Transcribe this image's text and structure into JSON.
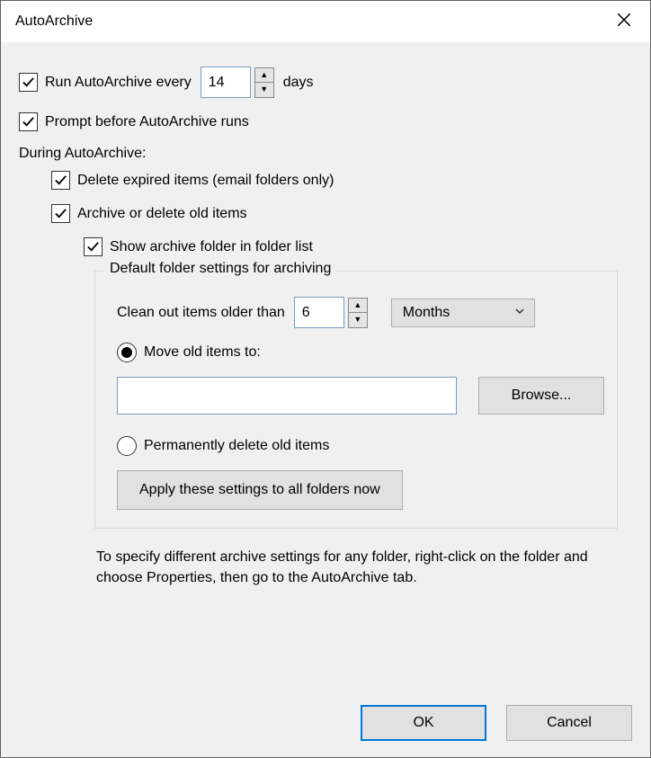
{
  "title": "AutoArchive",
  "run_every_label_prefix": "Run AutoArchive every",
  "run_every_value": "14",
  "run_every_label_suffix": "days",
  "prompt_label": "Prompt before AutoArchive runs",
  "during_label": "During AutoArchive:",
  "delete_expired_label": "Delete expired items (email folders only)",
  "archive_delete_label": "Archive or delete old items",
  "show_archive_label": "Show archive folder in folder list",
  "fieldset": {
    "legend": "Default folder settings for archiving",
    "clean_label": "Clean out items older than",
    "clean_value": "6",
    "unit_selected": "Months",
    "move_label": "Move old items to:",
    "move_path": "",
    "browse_label": "Browse...",
    "perm_delete_label": "Permanently delete old items",
    "apply_label": "Apply these settings to all folders now"
  },
  "hint": "To specify different archive settings for any folder, right-click on the folder and choose Properties, then go to the AutoArchive tab.",
  "ok_label": "OK",
  "cancel_label": "Cancel",
  "checks": {
    "run_every": true,
    "prompt": true,
    "delete_expired": true,
    "archive_delete": true,
    "show_archive": true
  },
  "radio_selected": "move"
}
